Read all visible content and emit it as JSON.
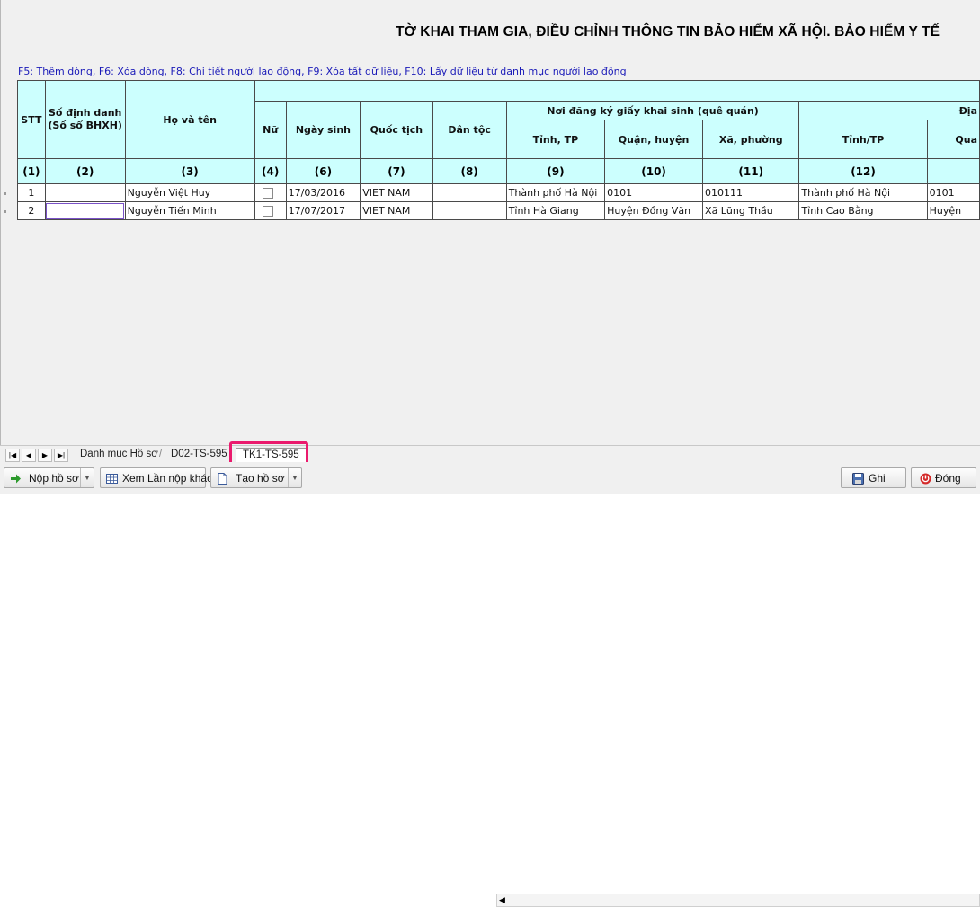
{
  "form": {
    "title": "TỜ KHAI THAM GIA, ĐIỀU CHỈNH THÔNG TIN BẢO HIỂM XÃ HỘI. BẢO HIỂM Y TẾ",
    "hint": "F5: Thêm dòng, F6: Xóa dòng, F8: Chi tiết người lao động, F9: Xóa tất dữ liệu, F10: Lấy dữ liệu từ danh mục người lao động"
  },
  "table": {
    "headers": {
      "stt": "STT",
      "so_dinh_danh_1": "Số định danh",
      "so_dinh_danh_2": "(Số sổ BHXH)",
      "ho_ten": "Họ và tên",
      "nu": "Nữ",
      "ngay_sinh": "Ngày sinh",
      "quoc_tich": "Quốc tịch",
      "dan_toc": "Dân tộc",
      "noi_dang_ky": "Nơi đăng ký giấy khai sinh (quê quán)",
      "tinh_tp": "Tỉnh, TP",
      "quan_huyen": "Quận, huyện",
      "xa_phuong": "Xã, phường",
      "dia_partial": "Địa",
      "tinh_tp_2": "Tỉnh/TP",
      "qua_partial": "Qua"
    },
    "column_numbers": [
      "(1)",
      "(2)",
      "(3)",
      "(4)",
      "(6)",
      "(7)",
      "(8)",
      "(9)",
      "(10)",
      "(11)",
      "(12)",
      ""
    ],
    "rows": [
      {
        "stt": "1",
        "so_dinh_danh": "",
        "ho_ten": "Nguyễn Việt Huy",
        "nu": false,
        "ngay_sinh": "17/03/2016",
        "quoc_tich": "VIET NAM",
        "dan_toc": "",
        "tinh_tp": "Thành phố Hà Nội",
        "quan_huyen": "0101",
        "xa_phuong": "010111",
        "tinh_tp_2": "Thành phố Hà Nội",
        "quan_huyen_2": "0101"
      },
      {
        "stt": "2",
        "so_dinh_danh": "",
        "ho_ten": "Nguyễn Tiến Minh",
        "nu": false,
        "ngay_sinh": "17/07/2017",
        "quoc_tich": "VIET NAM",
        "dan_toc": "",
        "tinh_tp": "Tỉnh Hà Giang",
        "quan_huyen": "Huyện Đồng Văn",
        "xa_phuong": "Xã Lũng Thầu",
        "tinh_tp_2": "Tỉnh Cao Bằng",
        "quan_huyen_2": "Huyện"
      }
    ]
  },
  "sheet_tabs": {
    "tabs": [
      "Danh mục Hồ sơ",
      "D02-TS-595",
      "TK1-TS-595"
    ],
    "active": "TK1-TS-595",
    "highlight_color": "#ea1a6d"
  },
  "nav_icons": [
    "first-icon",
    "prev-icon",
    "next-icon",
    "last-icon"
  ],
  "buttons": {
    "nop_ho_so": "Nộp hồ sơ",
    "xem_lan_nop_khac": "Xem Lần nộp khác",
    "tao_ho_so": "Tạo hồ sơ",
    "ghi": "Ghi",
    "dong": "Đóng"
  },
  "colors": {
    "header_bg": "#ccfffe",
    "hint_text": "#1a1ab8",
    "selection": "#7a52c7",
    "close_icon": "#d42a2a",
    "submit_icon": "#2c9a2c"
  }
}
